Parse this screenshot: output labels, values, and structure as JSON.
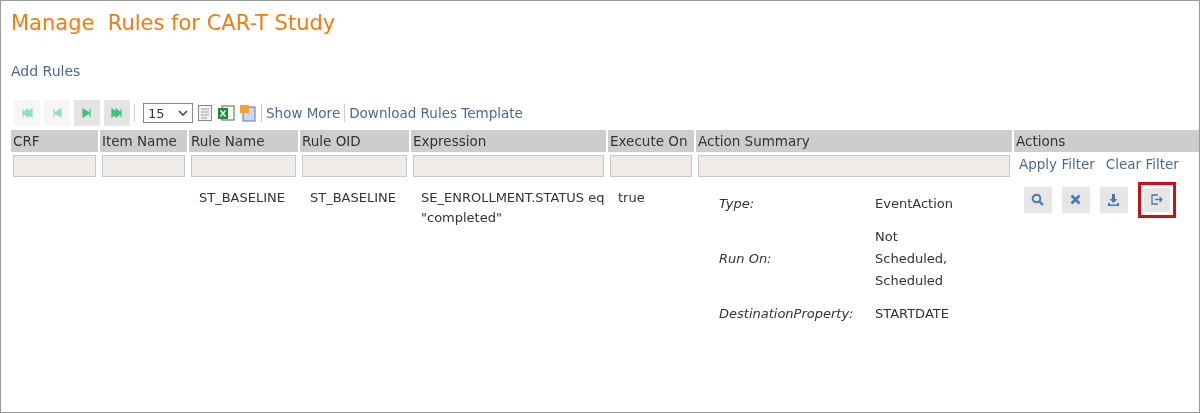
{
  "title": "Manage  Rules for CAR-T Study",
  "add_link": "Add Rules",
  "toolbar": {
    "pager": [
      {
        "kind": "first",
        "disabled": true
      },
      {
        "kind": "prev",
        "disabled": true
      },
      {
        "kind": "next",
        "disabled": false
      },
      {
        "kind": "last",
        "disabled": false
      }
    ],
    "page_size": "15",
    "links": [
      "Show More",
      "Download Rules Template"
    ]
  },
  "table": {
    "columns": [
      "CRF",
      "Item Name",
      "Rule Name",
      "Rule OID",
      "Expression",
      "Execute On",
      "Action Summary",
      "Actions"
    ],
    "filter_links": [
      "Apply Filter",
      "Clear Filter"
    ],
    "rows": [
      {
        "crf": "",
        "item_name": "",
        "rule_name": "ST_BASELINE",
        "rule_oid": "ST_BASELINE",
        "expression": "SE_ENROLLMENT.STATUS eq \"completed\"",
        "execute_on": "true",
        "summary": [
          {
            "label": "Type:",
            "value": "EventAction"
          },
          {
            "label": "Run On:",
            "value": "Not Scheduled, Scheduled"
          },
          {
            "label": "DestinationProperty:",
            "value": "STARTDATE"
          }
        ],
        "actions": [
          {
            "kind": "view",
            "highlighted": false
          },
          {
            "kind": "remove",
            "highlighted": false
          },
          {
            "kind": "download",
            "highlighted": false
          },
          {
            "kind": "run",
            "highlighted": true
          }
        ]
      }
    ]
  }
}
